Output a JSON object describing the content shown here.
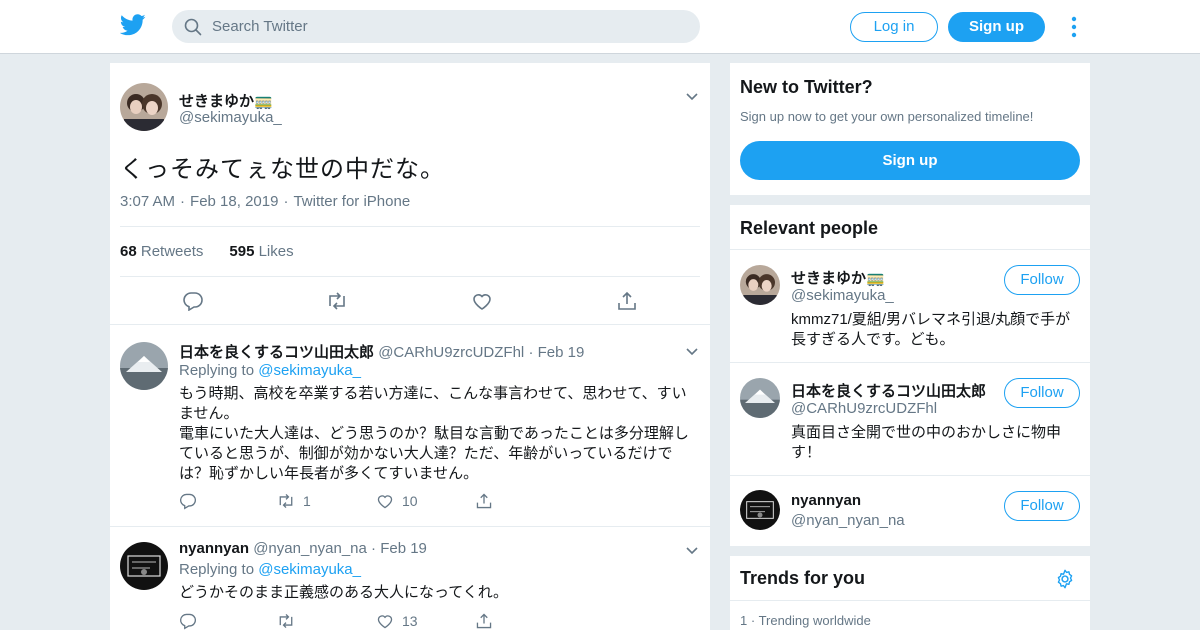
{
  "colors": {
    "accent": "#1da1f2",
    "background": "#e6ecf0",
    "text": "#14171a",
    "muted": "#657786"
  },
  "nav": {
    "search_placeholder": "Search Twitter",
    "login_label": "Log in",
    "signup_label": "Sign up"
  },
  "tweet": {
    "author_name": "せきまゆか🚃",
    "author_handle": "@sekimayuka_",
    "text": "くっそみてぇな世の中だな。",
    "time": "3:07 AM",
    "date": "Feb 18, 2019",
    "source": "Twitter for iPhone",
    "retweets_count": "68",
    "retweets_label": "Retweets",
    "likes_count": "595",
    "likes_label": "Likes"
  },
  "replies": [
    {
      "name": "日本を良くするコツ山田太郎",
      "handle": "@CARhU9zrcUDZFhl",
      "date": "Feb 19",
      "replying_prefix": "Replying to",
      "replying_to": "@sekimayuka_",
      "lines": [
        "もう時期、高校を卒業する若い方達に、こんな事言わせて、思わせて、すい",
        "ません。",
        "電車にいた大人達は、どう思うのか？駄目な言動であったことは多分理解し",
        "ていると思うが、制御が効かない大人達？ただ、年齢がいっているだけで",
        "は？恥ずかしい年長者が多くてすいません。"
      ],
      "retweets": "1",
      "likes": "10"
    },
    {
      "name": "nyannyan",
      "handle": "@nyan_nyan_na",
      "date": "Feb 19",
      "replying_prefix": "Replying to",
      "replying_to": "@sekimayuka_",
      "lines": [
        "どうかそのまま正義感のある大人になってくれ。"
      ],
      "retweets": "",
      "likes": "13"
    }
  ],
  "new_to_twitter": {
    "title": "New to Twitter?",
    "subtitle": "Sign up now to get your own personalized timeline!",
    "button": "Sign up"
  },
  "relevant_people": {
    "title": "Relevant people",
    "follow_label": "Follow",
    "people": [
      {
        "name": "せきまゆか🚃",
        "handle": "@sekimayuka_",
        "bio_lines": [
          "kmmz71/夏組/男バレマネ引退/丸顔で手が",
          "長すぎる人です。ども。"
        ]
      },
      {
        "name": "日本を良くするコツ山田太郎",
        "handle": "@CARhU9zrcUDZFhl",
        "bio_lines": [
          "真面目さ全開で世の中のおかしさに物申",
          "す！"
        ]
      },
      {
        "name": "nyannyan",
        "handle": "@nyan_nyan_na",
        "bio_lines": []
      }
    ]
  },
  "trends": {
    "title": "Trends for you",
    "first_rank": "1",
    "first_meta": "Trending worldwide"
  }
}
